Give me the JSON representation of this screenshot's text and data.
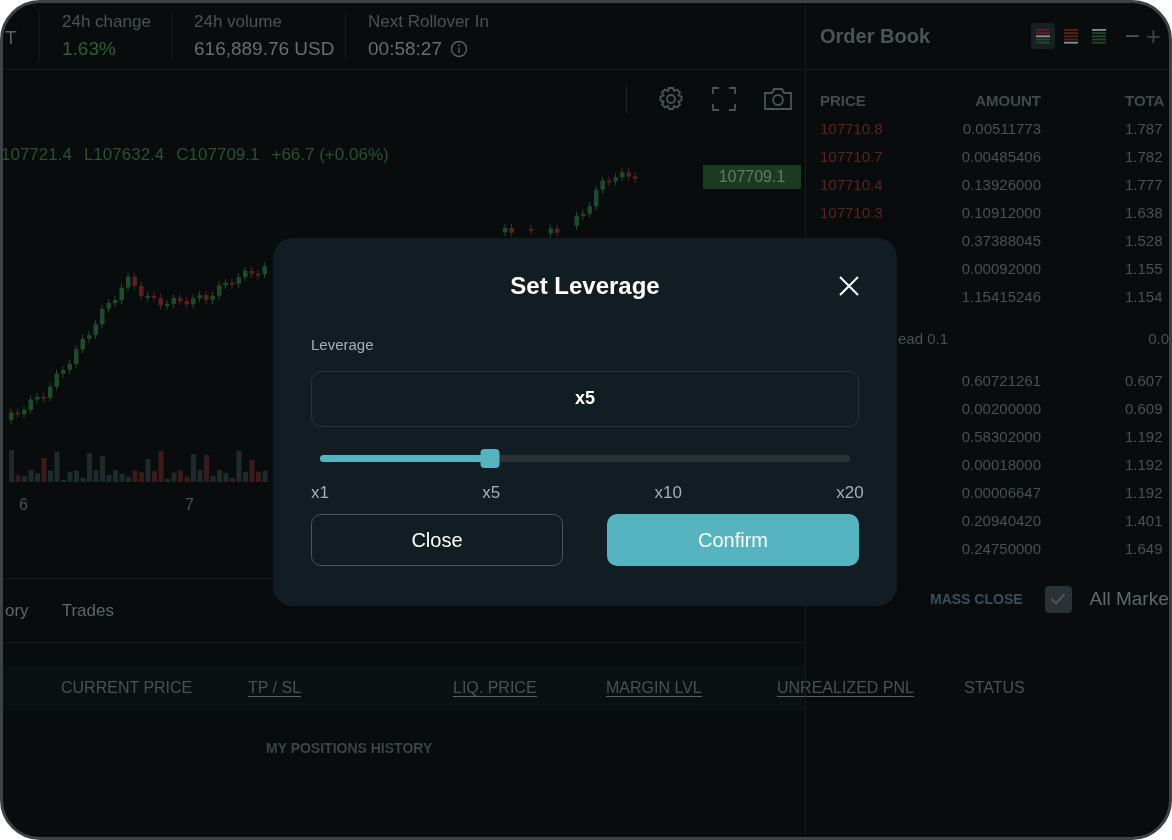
{
  "header": {
    "symbol_fragment": "T",
    "stats": [
      {
        "kind": "change",
        "label": "24h change",
        "value": "1.63%"
      },
      {
        "kind": "plain",
        "label": "24h volume",
        "value": "616,889.76 USD"
      },
      {
        "kind": "timer",
        "label": "Next Rollover In",
        "value": "00:58:27"
      }
    ]
  },
  "chart": {
    "legend": [
      "107721.4",
      "L107632.4",
      "C107709.1",
      "+66.7 (+0.06%)"
    ],
    "last_price": "107709.1",
    "x_labels": [
      "6",
      "7"
    ]
  },
  "positions": {
    "tabs": [
      {
        "label": "ory",
        "selected": false
      },
      {
        "label": "Trades",
        "selected": false
      }
    ],
    "mass_close": "MASS CLOSE",
    "all_markets": {
      "label": "All Marke",
      "checked": true
    },
    "columns": [
      {
        "label": "CURRENT PRICE",
        "underlined": false
      },
      {
        "label": "TP / SL",
        "underlined": true
      },
      {
        "label": "LIQ. PRICE",
        "underlined": true
      },
      {
        "label": "MARGIN LVL",
        "underlined": true
      },
      {
        "label": "UNREALIZED PNL",
        "underlined": true
      },
      {
        "label": "STATUS",
        "underlined": false
      }
    ],
    "empty_message": "MY POSITIONS HISTORY"
  },
  "order_book": {
    "title": "Order Book",
    "views": [
      {
        "kind": "both",
        "selected": true
      },
      {
        "kind": "asks",
        "selected": false
      },
      {
        "kind": "bids",
        "selected": false
      }
    ],
    "zoom_out": "−",
    "zoom_in": "+",
    "columns": [
      "PRICE",
      "AMOUNT",
      "TOTA"
    ],
    "asks": [
      {
        "price": "107710.8",
        "amount": "0.00511773",
        "total": "1.787"
      },
      {
        "price": "107710.7",
        "amount": "0.00485406",
        "total": "1.782"
      },
      {
        "price": "107710.4",
        "amount": "0.13926000",
        "total": "1.777"
      },
      {
        "price": "107710.3",
        "amount": "0.10912000",
        "total": "1.638"
      },
      {
        "amount": "0.37388045",
        "total": "1.528"
      },
      {
        "amount": "0.00092000",
        "total": "1.155"
      },
      {
        "amount": "1.15415246",
        "total": "1.154"
      }
    ],
    "spread": {
      "label": "ead 0.1",
      "value": "0.0"
    },
    "bids": [
      {
        "amount": "0.60721261",
        "total": "0.607"
      },
      {
        "amount": "0.00200000",
        "total": "0.609"
      },
      {
        "amount": "0.58302000",
        "total": "1.192"
      },
      {
        "amount": "0.00018000",
        "total": "1.192"
      },
      {
        "amount": "0.00006647",
        "total": "1.192"
      },
      {
        "amount": "0.20940420",
        "total": "1.401"
      },
      {
        "amount": "0.24750000",
        "total": "1.649"
      }
    ]
  },
  "modal": {
    "title": "Set Leverage",
    "field_label": "Leverage",
    "value": "x5",
    "slider": {
      "level": 0.32
    },
    "ticks": [
      "x1",
      "x5",
      "x10",
      "x20"
    ],
    "buttons": [
      {
        "kind": "secondary",
        "label": "Close"
      },
      {
        "kind": "primary",
        "label": "Confirm"
      }
    ]
  }
}
